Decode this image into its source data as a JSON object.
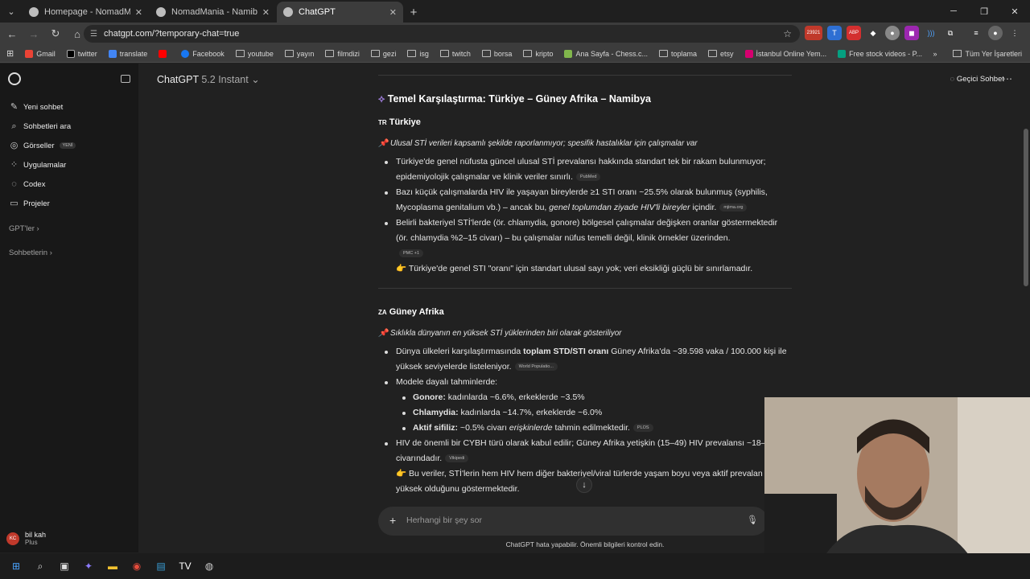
{
  "browser": {
    "tabs": [
      {
        "title": "Homepage - NomadMania"
      },
      {
        "title": "NomadMania - Namibia - Khon"
      },
      {
        "title": "ChatGPT"
      }
    ],
    "url": "chatgpt.com/?temporary-chat=true",
    "ext_badge": "23921",
    "bookmarks": [
      "Gmail",
      "twitter",
      "translate",
      "Facebook",
      "youtube",
      "yayın",
      "filmdizi",
      "gezi",
      "isg",
      "twitch",
      "borsa",
      "kripto",
      "Ana Sayfa - Chess.c...",
      "toplama",
      "etsy",
      "İstanbul Online Yem...",
      "Free stock videos - P..."
    ],
    "bookmarks_all": "Tüm Yer İşaretleri"
  },
  "sidebar": {
    "items": [
      {
        "label": "Yeni sohbet",
        "icon": "edit-icon"
      },
      {
        "label": "Sohbetleri ara",
        "icon": "search-icon"
      },
      {
        "label": "Görseller",
        "icon": "image-icon",
        "badge": "YENİ"
      },
      {
        "label": "Uygulamalar",
        "icon": "apps-icon"
      },
      {
        "label": "Codex",
        "icon": "codex-icon"
      },
      {
        "label": "Projeler",
        "icon": "folder-icon"
      }
    ],
    "gpts": "GPT'ler",
    "chats": "Sohbetlerin",
    "user": {
      "initials": "KC",
      "name": "bil kah",
      "plan": "Plus"
    }
  },
  "header": {
    "model": "ChatGPT",
    "version": "5.2 Instant",
    "temp_chat": "Geçici Sohbet"
  },
  "article": {
    "h2": "Temel Karşılaştırma: Türkiye – Güney Afrika – Namibya",
    "turkey": {
      "title": "Türkiye",
      "flag": "TR",
      "note": "Ulusal STİ verileri kapsamlı şekilde raporlanmıyor; spesifik hastalıklar için çalışmalar var",
      "b1": "Türkiye'de genel nüfusta güncel ulusal STİ prevalansı hakkında standart tek bir rakam bulunmuyor; epidemiyolojik çalışmalar ve klinik veriler sınırlı.",
      "b1src": "PubMed",
      "b2a": "Bazı küçük çalışmalarda HIV ile yaşayan bireylerde ≥1 STI oranı ~25.5% olarak bulunmuş (syphilis, Mycoplasma genitalium vb.) – ancak bu, ",
      "b2em": "genel toplumdan ziyade HIV'li bireyler",
      "b2b": " içindir.",
      "b2src": "mjima.org",
      "b3": "Belirli bakteriyel STİ'lerde (ör. chlamydia, gonore) bölgesel çalışmalar değişken oranlar göstermektedir (ör. chlamydia %2–15 civarı) – bu çalışmalar nüfus temelli değil, klinik örnekler üzerinden.",
      "b3src": "PMC +1",
      "point": "Türkiye'de genel STI \"oranı\" için standart ulusal sayı yok; veri eksikliği güçlü bir sınırlamadır."
    },
    "sa": {
      "title": "Güney Afrika",
      "flag": "ZA",
      "note": "Sıklıkla dünyanın en yüksek STİ yüklerinden biri olarak gösteriliyor",
      "b1a": "Dünya ülkeleri karşılaştırmasında ",
      "b1strong": "toplam STD/STI oranı",
      "b1b": " Güney Afrika'da ~39.598 vaka / 100.000 kişi ile yüksek seviyelerde listeleniyor.",
      "b1src": "World Populatio...",
      "b2": "Modele dayalı tahminlerde:",
      "s1k": "Gonore:",
      "s1v": " kadınlarda ~6.6%, erkeklerde ~3.5%",
      "s2k": "Chlamydia:",
      "s2v": " kadınlarda ~14.7%, erkeklerde ~6.0%",
      "s3k": "Aktif sifiliz:",
      "s3v": " ~0.5% civarı ",
      "s3em": "erişkinlerde",
      "s3v2": " tahmin edilmektedir.",
      "s3src": "PLOS",
      "b3": "HIV de önemli bir CYBH türü olarak kabul edilir; Güney Afrika yetişkin (15–49) HIV prevalansı ~18– civarındadır.",
      "b3src": "Vikipedi",
      "point": "Bu veriler, STİ'lerin hem HIV hem diğer bakteriyel/viral türlerde yaşam boyu veya aktif prevalan görece yüksek olduğunu göstermektedir."
    }
  },
  "composer": {
    "placeholder": "Herhangi bir şey sor",
    "disclaimer": "ChatGPT hata yapabilir. Önemli bilgileri kontrol edin."
  }
}
